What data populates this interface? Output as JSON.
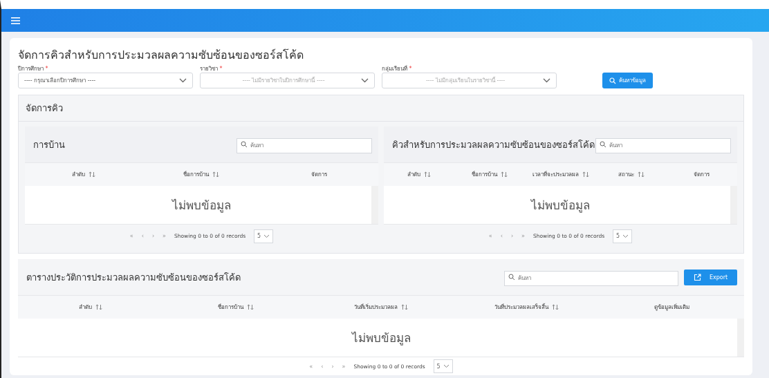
{
  "page": {
    "title": "จัดการคิวสำหรับการประมวลผลความซับซ้อนของซอร์สโค้ด"
  },
  "filters": [
    {
      "label": "ปีการศึกษา",
      "required_mark": "*",
      "placeholder": "---- กรุณาเลือกปีการศึกษา ----",
      "disabled": false
    },
    {
      "label": "รายวิชา",
      "required_mark": "*",
      "placeholder": "---- ไม่มีรายวิชาในปีการศึกษานี้ ----",
      "disabled": true
    },
    {
      "label": "กลุ่มเรียนที่",
      "required_mark": "*",
      "placeholder": "---- ไม่มีกลุ่มเรียนในรายวิชานี้ ----",
      "disabled": true
    }
  ],
  "search_button": {
    "label": "ค้นหาข้อมูล"
  },
  "queue_section": {
    "title": "จัดการคิว",
    "panels": [
      {
        "title": "การบ้าน",
        "search_placeholder": "ค้นหา",
        "columns": [
          {
            "label": "ลำดับ",
            "sortable": true
          },
          {
            "label": "ชื่อการบ้าน",
            "sortable": true
          },
          {
            "label": "จัดการ",
            "sortable": false
          }
        ],
        "empty_text": "ไม่พบข้อมูล",
        "pagination": {
          "first": "«",
          "prev": "‹",
          "next": "›",
          "last": "»",
          "info": "Showing 0 to 0 of 0 records",
          "page_size": "5"
        }
      },
      {
        "title": "คิวสำหรับการประมวลผลความซับซ้อนของซอร์สโค้ด",
        "search_placeholder": "ค้นหา",
        "columns": [
          {
            "label": "ลำดับ",
            "sortable": true
          },
          {
            "label": "ชื่อการบ้าน",
            "sortable": true
          },
          {
            "label": "เวลาที่จะประมวลผล",
            "sortable": true
          },
          {
            "label": "สถานะ",
            "sortable": true
          },
          {
            "label": "จัดการ",
            "sortable": false
          }
        ],
        "empty_text": "ไม่พบข้อมูล",
        "pagination": {
          "first": "«",
          "prev": "‹",
          "next": "›",
          "last": "»",
          "info": "Showing 0 to 0 of 0 records",
          "page_size": "5"
        }
      }
    ]
  },
  "history": {
    "title": "ตารางประวัติการประมวลผลความซับซ้อนของซอร์สโค้ด",
    "search_placeholder": "ค้นหา",
    "export_label": "Export",
    "columns": [
      {
        "label": "ลำดับ",
        "sortable": true
      },
      {
        "label": "ชื่อการบ้าน",
        "sortable": true
      },
      {
        "label": "วันที่เริ่มประมวลผล",
        "sortable": true
      },
      {
        "label": "วันที่ประมวลผลเสร็จสิ้น",
        "sortable": true
      },
      {
        "label": "ดูข้อมูลเพิ่มเติม",
        "sortable": false
      }
    ],
    "empty_text": "ไม่พบข้อมูล",
    "pagination": {
      "first": "«",
      "prev": "‹",
      "next": "›",
      "last": "»",
      "info": "Showing 0 to 0 of 0 records",
      "page_size": "5"
    }
  }
}
